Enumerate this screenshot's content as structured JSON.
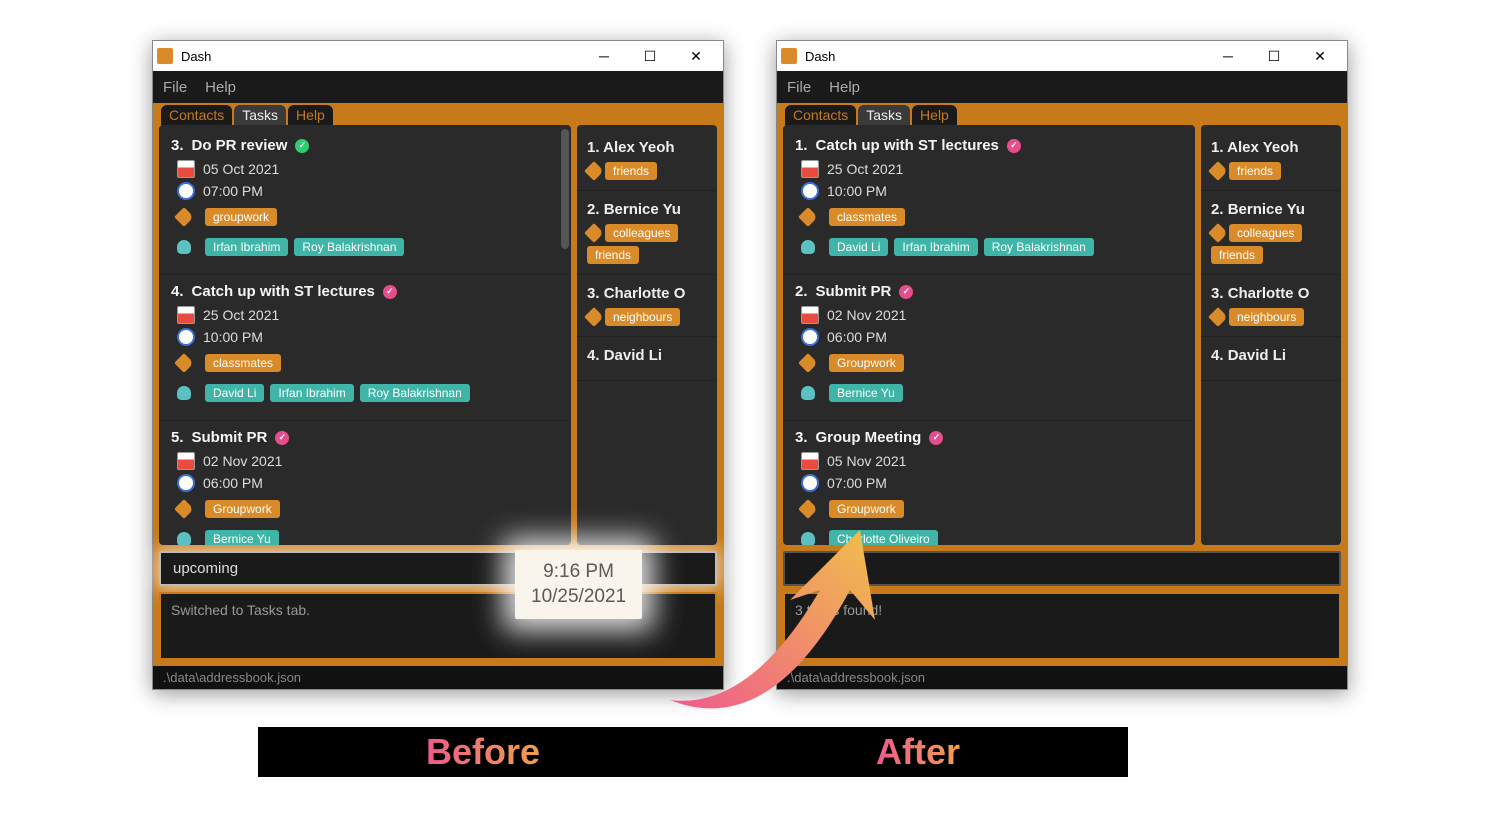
{
  "app": {
    "title": "Dash"
  },
  "menu": {
    "file": "File",
    "help": "Help"
  },
  "tabs": {
    "contacts": "Contacts",
    "tasks": "Tasks",
    "help": "Help"
  },
  "before": {
    "tasks": [
      {
        "num": "3.",
        "title": "Do PR review",
        "check": "green",
        "date": "05 Oct 2021",
        "time": "07:00 PM",
        "tags": [
          "groupwork"
        ],
        "people": [
          "Irfan Ibrahim",
          "Roy Balakrishnan"
        ]
      },
      {
        "num": "4.",
        "title": "Catch up with ST lectures",
        "check": "pink",
        "date": "25 Oct 2021",
        "time": "10:00 PM",
        "tags": [
          "classmates"
        ],
        "people": [
          "David Li",
          "Irfan Ibrahim",
          "Roy Balakrishnan"
        ]
      },
      {
        "num": "5.",
        "title": "Submit PR",
        "check": "pink",
        "date": "02 Nov 2021",
        "time": "06:00 PM",
        "tags": [
          "Groupwork"
        ],
        "people": [
          "Bernice Yu"
        ]
      }
    ],
    "cmd": "upcoming",
    "status": "Switched to Tasks tab.",
    "footer": ".\\data\\addressbook.json"
  },
  "after": {
    "tasks": [
      {
        "num": "1.",
        "title": "Catch up with ST lectures",
        "check": "pink",
        "date": "25 Oct 2021",
        "time": "10:00 PM",
        "tags": [
          "classmates"
        ],
        "people": [
          "David Li",
          "Irfan Ibrahim",
          "Roy Balakrishnan"
        ]
      },
      {
        "num": "2.",
        "title": "Submit PR",
        "check": "pink",
        "date": "02 Nov 2021",
        "time": "06:00 PM",
        "tags": [
          "Groupwork"
        ],
        "people": [
          "Bernice Yu"
        ]
      },
      {
        "num": "3.",
        "title": "Group Meeting",
        "check": "pink",
        "date": "05 Nov 2021",
        "time": "07:00 PM",
        "tags": [
          "Groupwork"
        ],
        "people": [
          "Charlotte Oliveiro"
        ]
      }
    ],
    "cmd": "",
    "status": "3 tasks found!",
    "footer": ".\\data\\addressbook.json"
  },
  "contacts": [
    {
      "num": "1.",
      "name": "Alex Yeoh",
      "tags": [
        "friends"
      ]
    },
    {
      "num": "2.",
      "name": "Bernice Yu",
      "tags": [
        "colleagues",
        "friends"
      ]
    },
    {
      "num": "3.",
      "name": "Charlotte O",
      "tags": [
        "neighbours"
      ]
    },
    {
      "num": "4.",
      "name": "David Li",
      "tags": []
    }
  ],
  "clock": {
    "time": "9:16 PM",
    "date": "10/25/2021"
  },
  "labels": {
    "before": "Before",
    "after": "After"
  }
}
